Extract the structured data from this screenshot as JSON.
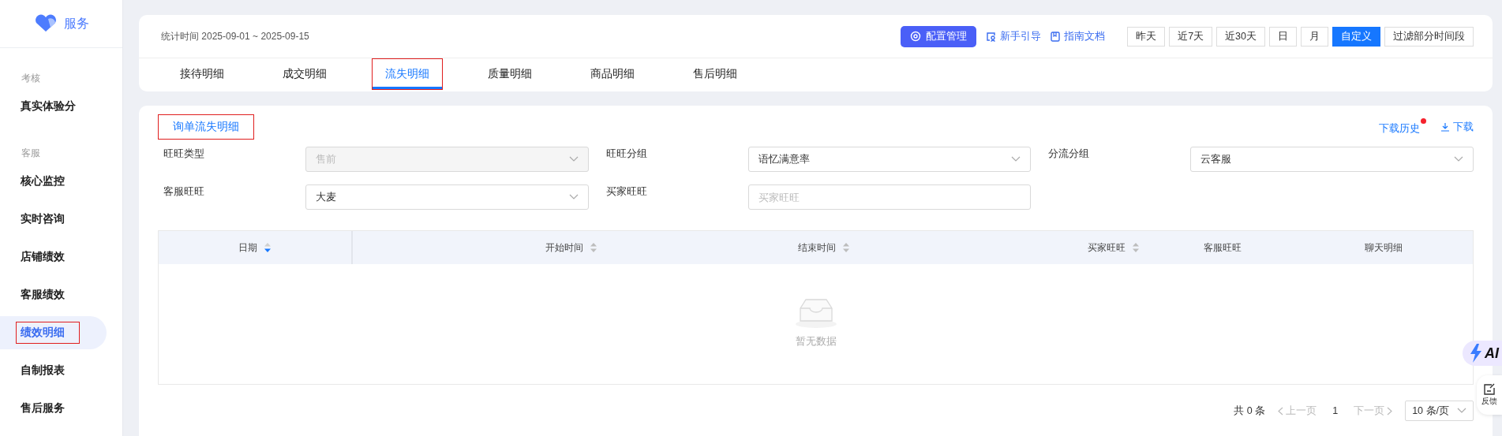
{
  "sidebar": {
    "brand": "服务",
    "groups": [
      {
        "title": "考核",
        "items": [
          {
            "label": "真实体验分",
            "selected": false,
            "highlighted": false
          }
        ]
      },
      {
        "title": "客服",
        "items": [
          {
            "label": "核心监控",
            "selected": false,
            "highlighted": false
          },
          {
            "label": "实时咨询",
            "selected": false,
            "highlighted": false
          },
          {
            "label": "店铺绩效",
            "selected": false,
            "highlighted": false
          },
          {
            "label": "客服绩效",
            "selected": false,
            "highlighted": false
          },
          {
            "label": "绩效明细",
            "selected": true,
            "highlighted": true
          },
          {
            "label": "自制报表",
            "selected": false,
            "highlighted": false
          },
          {
            "label": "售后服务",
            "selected": false,
            "highlighted": false
          }
        ]
      }
    ]
  },
  "header": {
    "stat_time": "统计时间 2025-09-01 ~ 2025-09-15",
    "config_button": "配置管理",
    "guide_link": "新手引导",
    "docs_link": "指南文档",
    "ranges": [
      {
        "label": "昨天",
        "selected": false
      },
      {
        "label": "近7天",
        "selected": false
      },
      {
        "label": "近30天",
        "selected": false
      },
      {
        "label": "日",
        "selected": false
      },
      {
        "label": "月",
        "selected": false
      },
      {
        "label": "自定义",
        "selected": true
      },
      {
        "label": "过滤部分时间段",
        "selected": false
      }
    ]
  },
  "tabs": [
    {
      "label": "接待明细",
      "selected": false,
      "highlighted": false
    },
    {
      "label": "成交明细",
      "selected": false,
      "highlighted": false
    },
    {
      "label": "流失明细",
      "selected": true,
      "highlighted": true
    },
    {
      "label": "质量明细",
      "selected": false,
      "highlighted": false
    },
    {
      "label": "商品明细",
      "selected": false,
      "highlighted": false
    },
    {
      "label": "售后明细",
      "selected": false,
      "highlighted": false
    }
  ],
  "section": {
    "title": "询单流失明细",
    "highlighted": true,
    "download_history": "下载历史",
    "download_history_notice": true,
    "download": "下载"
  },
  "filters": [
    {
      "label": "旺旺类型",
      "kind": "select",
      "value": "售前",
      "disabled": true
    },
    {
      "label": "旺旺分组",
      "kind": "select",
      "value": "语忆满意率",
      "disabled": false
    },
    {
      "label": "分流分组",
      "kind": "select",
      "value": "云客服",
      "disabled": false
    },
    {
      "label": "客服旺旺",
      "kind": "select",
      "value": "大麦",
      "disabled": false
    },
    {
      "label": "买家旺旺",
      "kind": "input",
      "placeholder": "买家旺旺"
    }
  ],
  "table": {
    "columns": [
      {
        "label": "日期",
        "sortable": true,
        "sorted": true
      },
      {
        "label": "开始时间",
        "sortable": true,
        "sorted": false
      },
      {
        "label": "结束时间",
        "sortable": true,
        "sorted": false
      },
      {
        "label": "买家旺旺",
        "sortable": true,
        "sorted": false
      },
      {
        "label": "客服旺旺",
        "sortable": false
      },
      {
        "label": "聊天明细",
        "sortable": false
      }
    ],
    "empty_text": "暂无数据"
  },
  "pagination": {
    "total": "共 0 条",
    "prev": "上一页",
    "page": "1",
    "next": "下一页",
    "page_size": "10 条/页"
  },
  "floating": {
    "ai": "AI",
    "feedback": "反馈"
  }
}
